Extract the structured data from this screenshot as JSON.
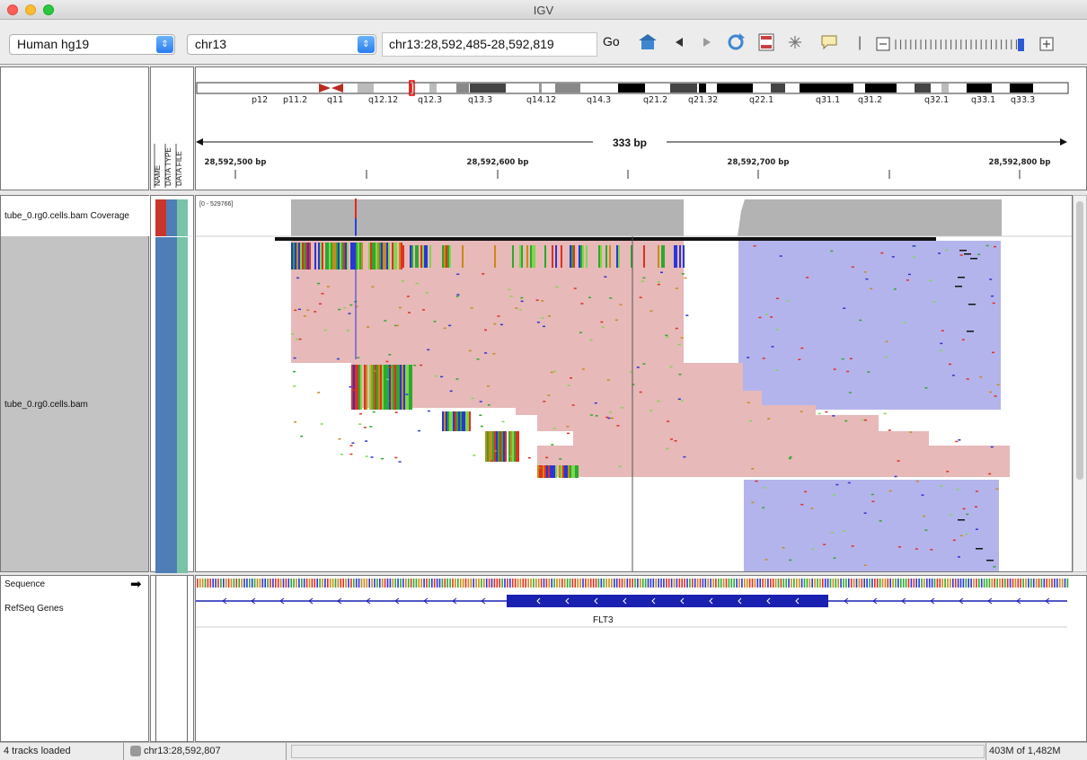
{
  "window": {
    "title": "IGV"
  },
  "toolbar": {
    "genome": "Human hg19",
    "chromosome": "chr13",
    "locus": "chr13:28,592,485-28,592,819",
    "go_label": "Go"
  },
  "ideogram": {
    "bands": [
      "p12",
      "p11.2",
      "q11",
      "q12.12",
      "q12.3",
      "q13.3",
      "q14.12",
      "q14.3",
      "q21.2",
      "q21.32",
      "q22.1",
      "q31.1",
      "q31.2",
      "q32.1",
      "q33.1",
      "q33.3"
    ]
  },
  "ruler": {
    "span_label": "333 bp",
    "ticks": [
      "28,592,500 bp",
      "28,592,600 bp",
      "28,592,700 bp",
      "28,592,800 bp"
    ]
  },
  "attribute_headers": [
    "NAME",
    "DATA TYPE",
    "DATA FILE"
  ],
  "tracks": {
    "coverage_name": "tube_0.rg0.cells.bam Coverage",
    "coverage_range": "[0 - 529766]",
    "alignment_name": "tube_0.rg0.cells.bam",
    "sequence_name": "Sequence",
    "genes_name": "RefSeq Genes",
    "gene_label": "FLT3"
  },
  "status": {
    "tracks_loaded": "4 tracks loaded",
    "position": "chr13:28,592,807",
    "memory": "403M of 1,482M"
  },
  "colors": {
    "forward_read": "#e7b9b9",
    "reverse_read": "#b4b4ec",
    "coverage": "#b3b3b3",
    "gene": "#1a20b0",
    "attr_name": "#c9352c",
    "attr_type": "#4f7eb6",
    "attr_file": "#79c3a6"
  }
}
